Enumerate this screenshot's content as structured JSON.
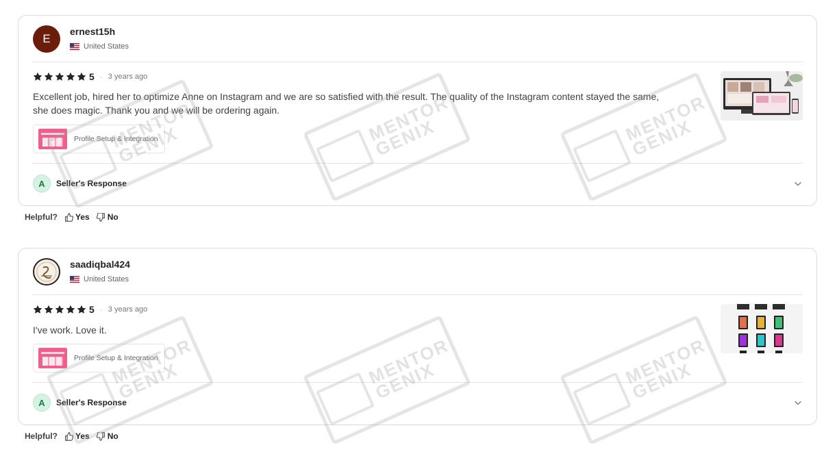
{
  "reviews": [
    {
      "username": "ernest15h",
      "avatar_letter": "E",
      "country": "United States",
      "rating": "5",
      "time": "3 years ago",
      "text": "Excellent job, hired her to optimize Anne on Instagram and we are so satisfied with the result. The quality of the Instagram content stayed the same, she does magic. Thank you and we will be ordering again.",
      "gig_title": "Profile Setup & Integration",
      "seller_response_label": "Seller's Response",
      "seller_avatar_letter": "A",
      "helpful_label": "Helpful?",
      "yes_label": "Yes",
      "no_label": "No"
    },
    {
      "username": "saadiqbal424",
      "country": "United States",
      "rating": "5",
      "time": "3 years ago",
      "text": "I've work. Love it.",
      "gig_title": "Profile Setup & Integration",
      "seller_response_label": "Seller's Response",
      "seller_avatar_letter": "A",
      "helpful_label": "Helpful?",
      "yes_label": "Yes",
      "no_label": "No"
    }
  ],
  "watermark": {
    "line1": "MENTOR",
    "line2": "GENIX"
  },
  "colors": {
    "star": "#222325",
    "accent_green": "#1a7c4b",
    "avatar_brown": "#6b1d0b"
  }
}
